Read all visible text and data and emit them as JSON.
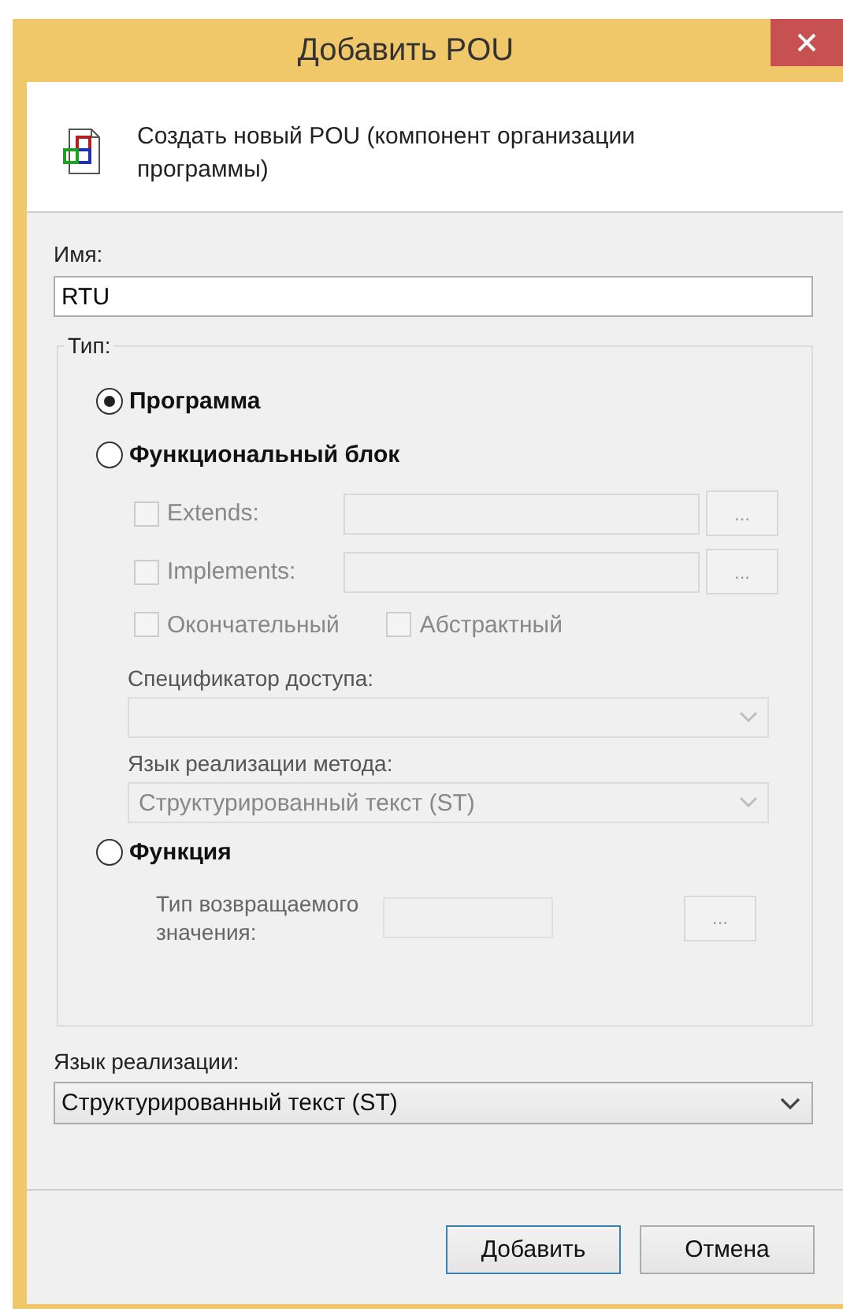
{
  "window": {
    "title": "Добавить POU"
  },
  "header": {
    "text": "Создать новый POU (компонент организации программы)"
  },
  "name": {
    "label": "Имя:",
    "value": "RTU"
  },
  "type_group": {
    "label": "Тип:",
    "items": [
      {
        "kind": "radio",
        "label": "Программа",
        "selected": true
      },
      {
        "kind": "radio",
        "label": "Функциональный блок",
        "selected": false
      },
      {
        "kind": "check_field",
        "label": "Extends:",
        "checked": false,
        "disabled": true,
        "button": "..."
      },
      {
        "kind": "check_field",
        "label": "Implements:",
        "checked": false,
        "disabled": true,
        "button": "..."
      },
      {
        "kind": "check_pair",
        "disabled": true,
        "checks": [
          {
            "label": "Окончательный",
            "checked": false
          },
          {
            "label": "Абстрактный",
            "checked": false
          }
        ]
      },
      {
        "kind": "combo",
        "label": "Спецификатор доступа:",
        "disabled": true
      },
      {
        "kind": "combo",
        "label": "Язык реализации метода:",
        "value": "Структурированный текст (ST)",
        "disabled": true
      },
      {
        "kind": "radio",
        "label": "Функция",
        "selected": false
      },
      {
        "kind": "text_field",
        "label": "Тип возвращаемого значения:",
        "button": "...",
        "disabled": true
      }
    ]
  },
  "implementation": {
    "label": "Язык реализации:",
    "value": "Структурированный текст (ST)"
  },
  "buttons": [
    {
      "label": "Добавить",
      "default": true
    },
    {
      "label": "Отмена",
      "default": false
    }
  ]
}
